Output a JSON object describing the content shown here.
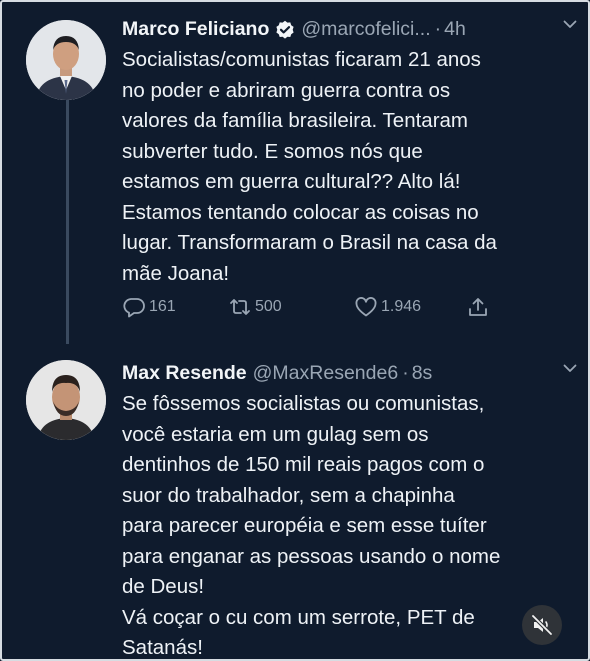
{
  "tweets": [
    {
      "name": "Marco Feliciano",
      "verified": true,
      "handle": "@marcofelici...",
      "separator": "·",
      "time": "4h",
      "text": "Socialistas/comunistas ficaram 21 anos\nno poder e abriram guerra contra os\nvalores da família brasileira. Tentaram\nsubverter tudo. E somos nós que\nestamos em guerra cultural?? Alto lá!\nEstamos tentando colocar as coisas no\nlugar. Transformaram o Brasil na casa da\nmãe Joana!",
      "actions": {
        "replies": "161",
        "retweets": "500",
        "likes": "1.946"
      }
    },
    {
      "name": "Max Resende",
      "handle": "@MaxResende6",
      "separator": "·",
      "time": "8s",
      "text": "Se fôssemos socialistas ou comunistas,\nvocê estaria em um gulag sem os\ndentinhos de 150 mil reais pagos com o\nsuor do trabalhador, sem a chapinha\npara parecer européia e sem esse tuíter\npara enganar as pessoas usando o nome\nde Deus!\nVá coçar o cu com um serrote, PET de\nSatanás!"
    }
  ],
  "icons": {
    "verified": "verified-badge-icon",
    "caret": "chevron-down-icon",
    "reply": "reply-icon",
    "retweet": "retweet-icon",
    "like": "heart-icon",
    "share": "share-icon",
    "mute": "sound-muted-icon"
  },
  "colors": {
    "background": "#0f1b2d",
    "text": "#eef2f6",
    "secondary": "#9aa6b4",
    "thread_line": "#3a4a5f"
  }
}
